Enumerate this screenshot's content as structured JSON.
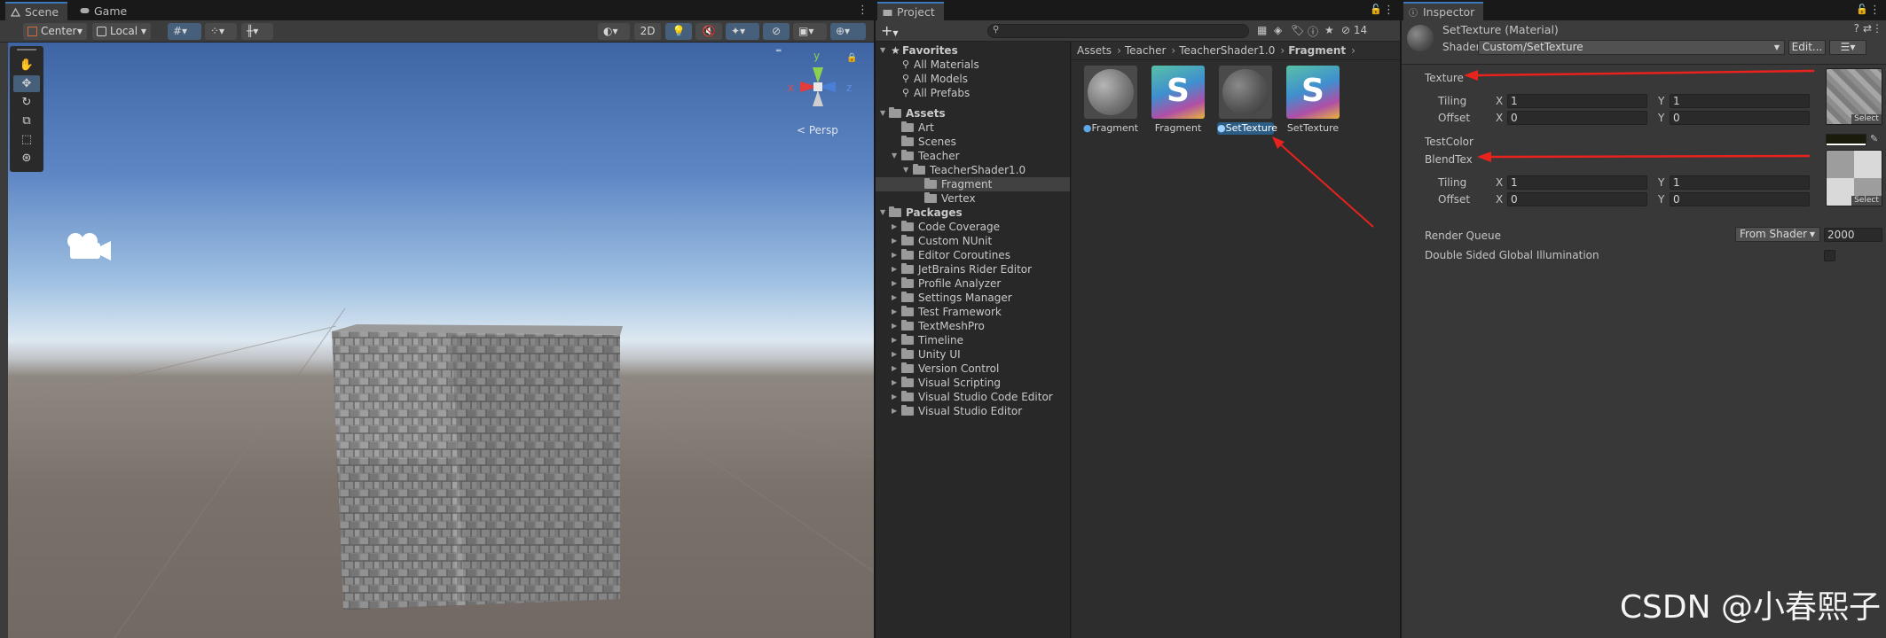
{
  "scene_panel": {
    "tabs": [
      {
        "label": "Scene"
      },
      {
        "label": "Game"
      }
    ],
    "toolbar": {
      "pivot_label": "Center",
      "space_label": "Local",
      "mode_2d_label": "2D"
    },
    "view_label": "< Persp",
    "gizmo_axes": {
      "y": "y",
      "x": "x",
      "z": "z"
    }
  },
  "project_panel": {
    "tab_label": "Project",
    "toolbar": {
      "add_label": "+",
      "hidden_count": "14"
    },
    "tree": {
      "favorites_label": "Favorites",
      "favorites": [
        "All Materials",
        "All Models",
        "All Prefabs"
      ],
      "assets_label": "Assets",
      "art": "Art",
      "scenes": "Scenes",
      "teacher": "Teacher",
      "teacher_shader": "TeacherShader1.0",
      "fragment": "Fragment",
      "vertex": "Vertex",
      "packages_label": "Packages",
      "packages": [
        "Code Coverage",
        "Custom NUnit",
        "Editor Coroutines",
        "JetBrains Rider Editor",
        "Profile Analyzer",
        "Settings Manager",
        "Test Framework",
        "TextMeshPro",
        "Timeline",
        "Unity UI",
        "Version Control",
        "Visual Scripting",
        "Visual Studio Code Editor",
        "Visual Studio Editor"
      ]
    },
    "breadcrumbs": [
      "Assets",
      "Teacher",
      "TeacherShader1.0",
      "Fragment"
    ],
    "assets": [
      {
        "label": "Fragment",
        "kind": "material"
      },
      {
        "label": "Fragment",
        "kind": "shader",
        "glyph": "S"
      },
      {
        "label": "SetTexture",
        "kind": "material",
        "selected": true
      },
      {
        "label": "SetTexture",
        "kind": "shader",
        "glyph": "S"
      }
    ]
  },
  "inspector_panel": {
    "tab_label": "Inspector",
    "title": "SetTexture (Material)",
    "shader_label": "Shader",
    "shader_value": "Custom/SetTexture",
    "edit_label": "Edit...",
    "texture_label": "Texture",
    "tiling_label": "Tiling",
    "offset_label": "Offset",
    "x_label": "X",
    "y_label": "Y",
    "tex_tiling": {
      "x": "1",
      "y": "1"
    },
    "tex_offset": {
      "x": "0",
      "y": "0"
    },
    "testcolor_label": "TestColor",
    "blendtex_label": "BlendTex",
    "blend_tiling": {
      "x": "1",
      "y": "1"
    },
    "blend_offset": {
      "x": "0",
      "y": "0"
    },
    "select_label": "Select",
    "render_queue_label": "Render Queue",
    "render_queue_mode": "From Shader",
    "render_queue_value": "2000",
    "dsgi_label": "Double Sided Global Illumination"
  },
  "watermark": "CSDN @小春熙子",
  "colors": {
    "accent": "#3a79bb",
    "annotation_arrow": "#e8221d",
    "selection": "#2c5d87"
  }
}
